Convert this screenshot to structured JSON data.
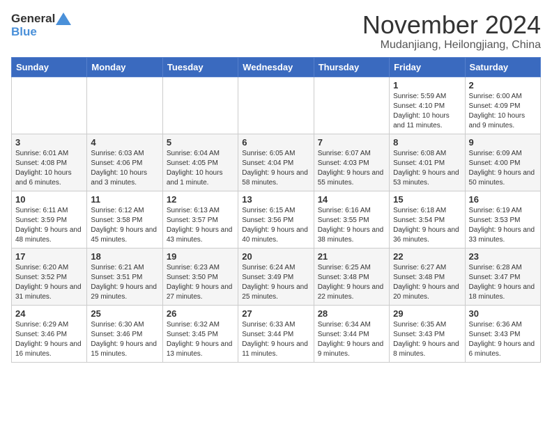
{
  "logo": {
    "general": "General",
    "blue": "Blue"
  },
  "title": "November 2024",
  "subtitle": "Mudanjiang, Heilongjiang, China",
  "weekdays": [
    "Sunday",
    "Monday",
    "Tuesday",
    "Wednesday",
    "Thursday",
    "Friday",
    "Saturday"
  ],
  "weeks": [
    [
      {
        "day": "",
        "sunrise": "",
        "sunset": "",
        "daylight": ""
      },
      {
        "day": "",
        "sunrise": "",
        "sunset": "",
        "daylight": ""
      },
      {
        "day": "",
        "sunrise": "",
        "sunset": "",
        "daylight": ""
      },
      {
        "day": "",
        "sunrise": "",
        "sunset": "",
        "daylight": ""
      },
      {
        "day": "",
        "sunrise": "",
        "sunset": "",
        "daylight": ""
      },
      {
        "day": "1",
        "sunrise": "Sunrise: 5:59 AM",
        "sunset": "Sunset: 4:10 PM",
        "daylight": "Daylight: 10 hours and 11 minutes."
      },
      {
        "day": "2",
        "sunrise": "Sunrise: 6:00 AM",
        "sunset": "Sunset: 4:09 PM",
        "daylight": "Daylight: 10 hours and 9 minutes."
      }
    ],
    [
      {
        "day": "3",
        "sunrise": "Sunrise: 6:01 AM",
        "sunset": "Sunset: 4:08 PM",
        "daylight": "Daylight: 10 hours and 6 minutes."
      },
      {
        "day": "4",
        "sunrise": "Sunrise: 6:03 AM",
        "sunset": "Sunset: 4:06 PM",
        "daylight": "Daylight: 10 hours and 3 minutes."
      },
      {
        "day": "5",
        "sunrise": "Sunrise: 6:04 AM",
        "sunset": "Sunset: 4:05 PM",
        "daylight": "Daylight: 10 hours and 1 minute."
      },
      {
        "day": "6",
        "sunrise": "Sunrise: 6:05 AM",
        "sunset": "Sunset: 4:04 PM",
        "daylight": "Daylight: 9 hours and 58 minutes."
      },
      {
        "day": "7",
        "sunrise": "Sunrise: 6:07 AM",
        "sunset": "Sunset: 4:03 PM",
        "daylight": "Daylight: 9 hours and 55 minutes."
      },
      {
        "day": "8",
        "sunrise": "Sunrise: 6:08 AM",
        "sunset": "Sunset: 4:01 PM",
        "daylight": "Daylight: 9 hours and 53 minutes."
      },
      {
        "day": "9",
        "sunrise": "Sunrise: 6:09 AM",
        "sunset": "Sunset: 4:00 PM",
        "daylight": "Daylight: 9 hours and 50 minutes."
      }
    ],
    [
      {
        "day": "10",
        "sunrise": "Sunrise: 6:11 AM",
        "sunset": "Sunset: 3:59 PM",
        "daylight": "Daylight: 9 hours and 48 minutes."
      },
      {
        "day": "11",
        "sunrise": "Sunrise: 6:12 AM",
        "sunset": "Sunset: 3:58 PM",
        "daylight": "Daylight: 9 hours and 45 minutes."
      },
      {
        "day": "12",
        "sunrise": "Sunrise: 6:13 AM",
        "sunset": "Sunset: 3:57 PM",
        "daylight": "Daylight: 9 hours and 43 minutes."
      },
      {
        "day": "13",
        "sunrise": "Sunrise: 6:15 AM",
        "sunset": "Sunset: 3:56 PM",
        "daylight": "Daylight: 9 hours and 40 minutes."
      },
      {
        "day": "14",
        "sunrise": "Sunrise: 6:16 AM",
        "sunset": "Sunset: 3:55 PM",
        "daylight": "Daylight: 9 hours and 38 minutes."
      },
      {
        "day": "15",
        "sunrise": "Sunrise: 6:18 AM",
        "sunset": "Sunset: 3:54 PM",
        "daylight": "Daylight: 9 hours and 36 minutes."
      },
      {
        "day": "16",
        "sunrise": "Sunrise: 6:19 AM",
        "sunset": "Sunset: 3:53 PM",
        "daylight": "Daylight: 9 hours and 33 minutes."
      }
    ],
    [
      {
        "day": "17",
        "sunrise": "Sunrise: 6:20 AM",
        "sunset": "Sunset: 3:52 PM",
        "daylight": "Daylight: 9 hours and 31 minutes."
      },
      {
        "day": "18",
        "sunrise": "Sunrise: 6:21 AM",
        "sunset": "Sunset: 3:51 PM",
        "daylight": "Daylight: 9 hours and 29 minutes."
      },
      {
        "day": "19",
        "sunrise": "Sunrise: 6:23 AM",
        "sunset": "Sunset: 3:50 PM",
        "daylight": "Daylight: 9 hours and 27 minutes."
      },
      {
        "day": "20",
        "sunrise": "Sunrise: 6:24 AM",
        "sunset": "Sunset: 3:49 PM",
        "daylight": "Daylight: 9 hours and 25 minutes."
      },
      {
        "day": "21",
        "sunrise": "Sunrise: 6:25 AM",
        "sunset": "Sunset: 3:48 PM",
        "daylight": "Daylight: 9 hours and 22 minutes."
      },
      {
        "day": "22",
        "sunrise": "Sunrise: 6:27 AM",
        "sunset": "Sunset: 3:48 PM",
        "daylight": "Daylight: 9 hours and 20 minutes."
      },
      {
        "day": "23",
        "sunrise": "Sunrise: 6:28 AM",
        "sunset": "Sunset: 3:47 PM",
        "daylight": "Daylight: 9 hours and 18 minutes."
      }
    ],
    [
      {
        "day": "24",
        "sunrise": "Sunrise: 6:29 AM",
        "sunset": "Sunset: 3:46 PM",
        "daylight": "Daylight: 9 hours and 16 minutes."
      },
      {
        "day": "25",
        "sunrise": "Sunrise: 6:30 AM",
        "sunset": "Sunset: 3:46 PM",
        "daylight": "Daylight: 9 hours and 15 minutes."
      },
      {
        "day": "26",
        "sunrise": "Sunrise: 6:32 AM",
        "sunset": "Sunset: 3:45 PM",
        "daylight": "Daylight: 9 hours and 13 minutes."
      },
      {
        "day": "27",
        "sunrise": "Sunrise: 6:33 AM",
        "sunset": "Sunset: 3:44 PM",
        "daylight": "Daylight: 9 hours and 11 minutes."
      },
      {
        "day": "28",
        "sunrise": "Sunrise: 6:34 AM",
        "sunset": "Sunset: 3:44 PM",
        "daylight": "Daylight: 9 hours and 9 minutes."
      },
      {
        "day": "29",
        "sunrise": "Sunrise: 6:35 AM",
        "sunset": "Sunset: 3:43 PM",
        "daylight": "Daylight: 9 hours and 8 minutes."
      },
      {
        "day": "30",
        "sunrise": "Sunrise: 6:36 AM",
        "sunset": "Sunset: 3:43 PM",
        "daylight": "Daylight: 9 hours and 6 minutes."
      }
    ]
  ]
}
